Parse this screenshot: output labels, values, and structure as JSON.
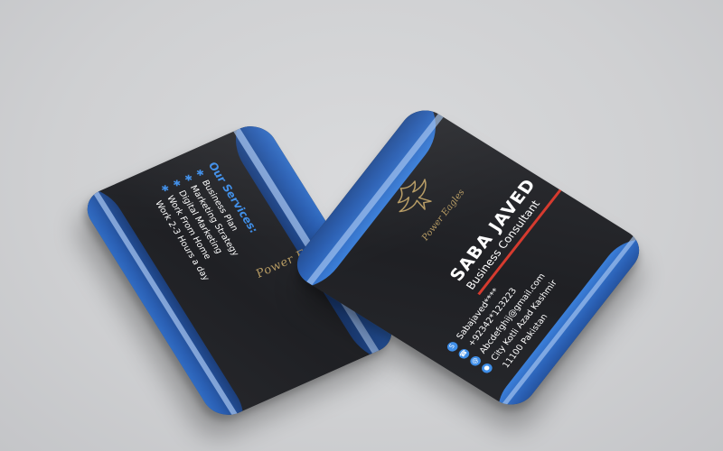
{
  "back_card": {
    "brand_name": "Power Eagles",
    "services_title": "Our Services:",
    "services": [
      "Business Plan",
      "Marketing Strategy",
      "Digital Marketing",
      "Work From Home",
      "Work 2-3 Hours a day"
    ]
  },
  "front_card": {
    "brand_name": "Power Eagles",
    "name": "SABA JAVED",
    "title": "Business Consultant",
    "contacts": [
      {
        "icon": "skype-icon",
        "glyph": "S",
        "text": "Sabajaved****"
      },
      {
        "icon": "phone-icon",
        "glyph": "☎",
        "text": "+92342*123223"
      },
      {
        "icon": "email-icon",
        "glyph": "@",
        "text": "Abcdefghij@gmail.com"
      },
      {
        "icon": "location-icon",
        "glyph": "●",
        "text": "City Kotli Azad Kashmir"
      },
      {
        "icon": "postal-icon",
        "glyph": "",
        "text": "11100 Pakistan"
      }
    ]
  },
  "colors": {
    "card": "#222327",
    "accent_blue": "#3f8ee8",
    "light_blue": "#a9c8f2",
    "gold": "#b59a63",
    "rule_red": "#d63b2f",
    "background": "#d2d3d5"
  }
}
